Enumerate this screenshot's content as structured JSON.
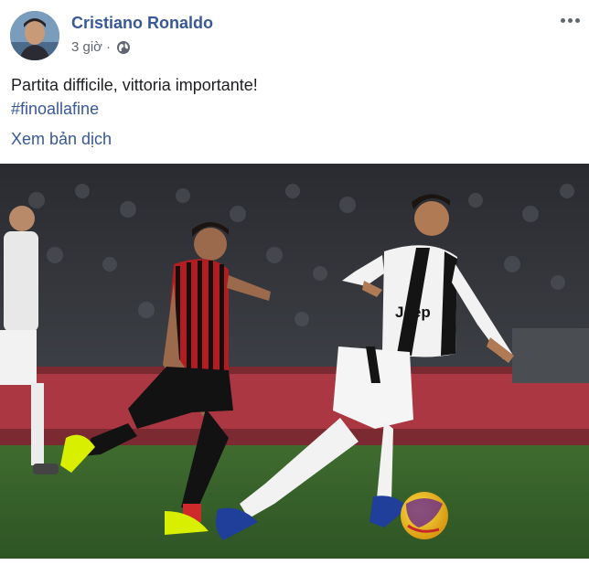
{
  "post": {
    "author": {
      "name": "Cristiano Ronaldo",
      "avatar_icon": "profile-photo"
    },
    "meta": {
      "timestamp": "3 giờ",
      "separator": "·",
      "privacy_icon": "globe-icon"
    },
    "menu_icon": "more-options-icon",
    "caption": {
      "text": "Partita difficile, vittoria importante!",
      "hashtag": "#finoallafine"
    },
    "translate_label": "Xem bản dịch",
    "photo": {
      "description_icon": "football-match-photo",
      "ad_text": "Jeep"
    },
    "colors": {
      "link": "#385898",
      "text": "#1c1e21",
      "meta": "#606770"
    }
  }
}
